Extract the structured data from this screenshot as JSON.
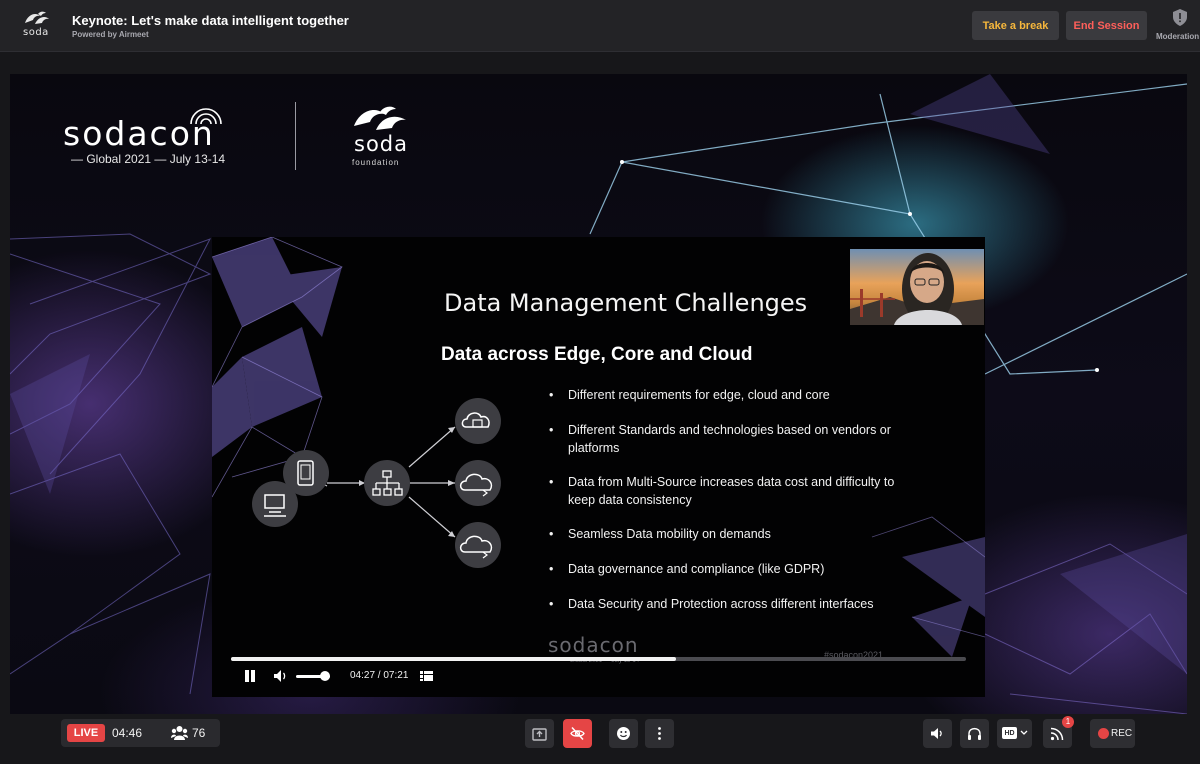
{
  "header": {
    "logo_text": "soda",
    "title": "Keynote: Let's make data intelligent together",
    "subtitle": "Powered by Airmeet",
    "take_break_label": "Take a break",
    "end_session_label": "End Session",
    "moderation_label": "Moderation"
  },
  "stage": {
    "event_logo": "sodacon",
    "event_tagline": "— Global 2021 —  July 13-14",
    "foundation_name": "soda",
    "foundation_sub": "foundation"
  },
  "slide": {
    "title": "Data Management Challenges",
    "subtitle": "Data across Edge, Core and Cloud",
    "bullets": [
      "Different requirements for edge, cloud and core",
      "Different Standards and technologies based on vendors or platforms",
      "Data from Multi-Source increases data cost and difficulty to keep data consistency",
      "Seamless Data mobility on demands",
      "Data governance and compliance (like GDPR)",
      "Data Security and Protection across different interfaces"
    ],
    "footer_logo": "sodacon",
    "footer_date": "— Global 2021 — July 13-14",
    "hashtag": "#sodacon2021"
  },
  "player": {
    "progress": 0.605,
    "volume": 0.85,
    "time": "04:27 / 07:21"
  },
  "bottom": {
    "live_label": "LIVE",
    "elapsed": "04:46",
    "attendees": "76",
    "hd_label": "HD",
    "notification_count": "1",
    "rec_label": "REC"
  },
  "colors": {
    "accent_yellow": "#f6b73c",
    "accent_red": "#ff5f5a",
    "live_red": "#e54545"
  }
}
